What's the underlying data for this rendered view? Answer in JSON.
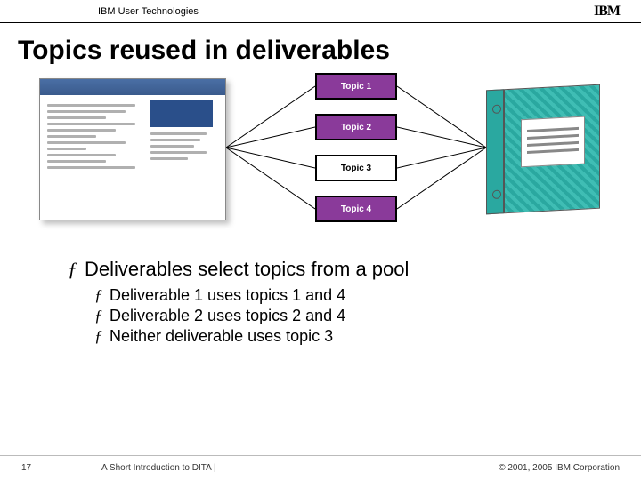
{
  "header": {
    "org": "IBM User Technologies",
    "logo": "IBM"
  },
  "title": "Topics reused in deliverables",
  "topics": {
    "t1": "Topic 1",
    "t2": "Topic 2",
    "t3": "Topic 3",
    "t4": "Topic 4"
  },
  "bullets": {
    "main": "Deliverables select topics from a pool",
    "subs": [
      "Deliverable 1 uses topics 1 and 4",
      "Deliverable 2 uses topics 2 and 4",
      "Neither deliverable uses topic 3"
    ]
  },
  "footer": {
    "page": "17",
    "mid": "A Short Introduction to DITA |",
    "right": "© 2001, 2005 IBM Corporation"
  },
  "colors": {
    "accent": "#8a3a9a",
    "teal": "#3fbdb4"
  }
}
